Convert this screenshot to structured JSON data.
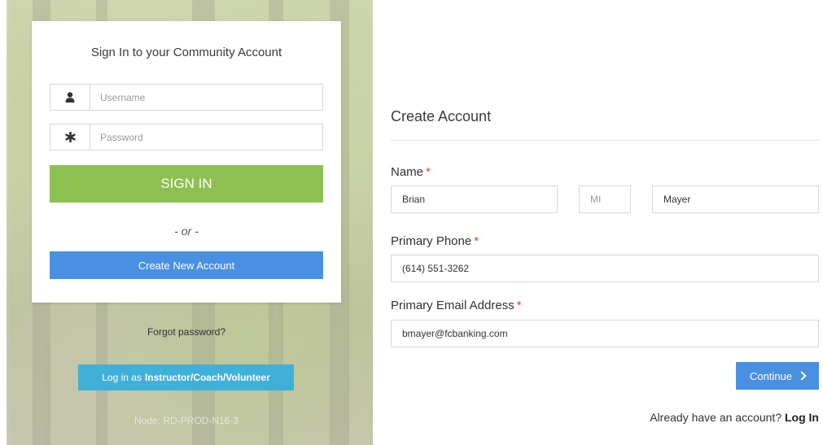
{
  "signin": {
    "title": "Sign In to your Community Account",
    "username_placeholder": "Username",
    "password_placeholder": "Password",
    "signin_label": "SIGN IN",
    "or_text": "- or -",
    "create_label": "Create New Account",
    "user_icon": "user-icon",
    "password_icon": "asterisk-icon"
  },
  "below_card": {
    "forgot_label": "Forgot password?",
    "instructor_prefix": "Log in as",
    "instructor_bold": "Instructor/Coach/Volunteer",
    "node_text": "Node: RD-PROD-N16-3"
  },
  "create_account": {
    "title": "Create Account",
    "name_label": "Name",
    "required_mark": "*",
    "first_name_value": "Brian",
    "middle_initial_placeholder": "MI",
    "last_name_value": "Mayer",
    "phone_label": "Primary Phone",
    "phone_value": "(614) 551-3262",
    "email_label": "Primary Email Address",
    "email_value": "bmayer@fcbanking.com",
    "continue_label": "Continue",
    "already_text": "Already have an account?",
    "login_link": "Log In"
  },
  "colors": {
    "signin_green": "#8cc152",
    "primary_blue": "#4a90e2",
    "instructor_cyan": "#41b0d8",
    "required_red": "#e23b3b"
  }
}
